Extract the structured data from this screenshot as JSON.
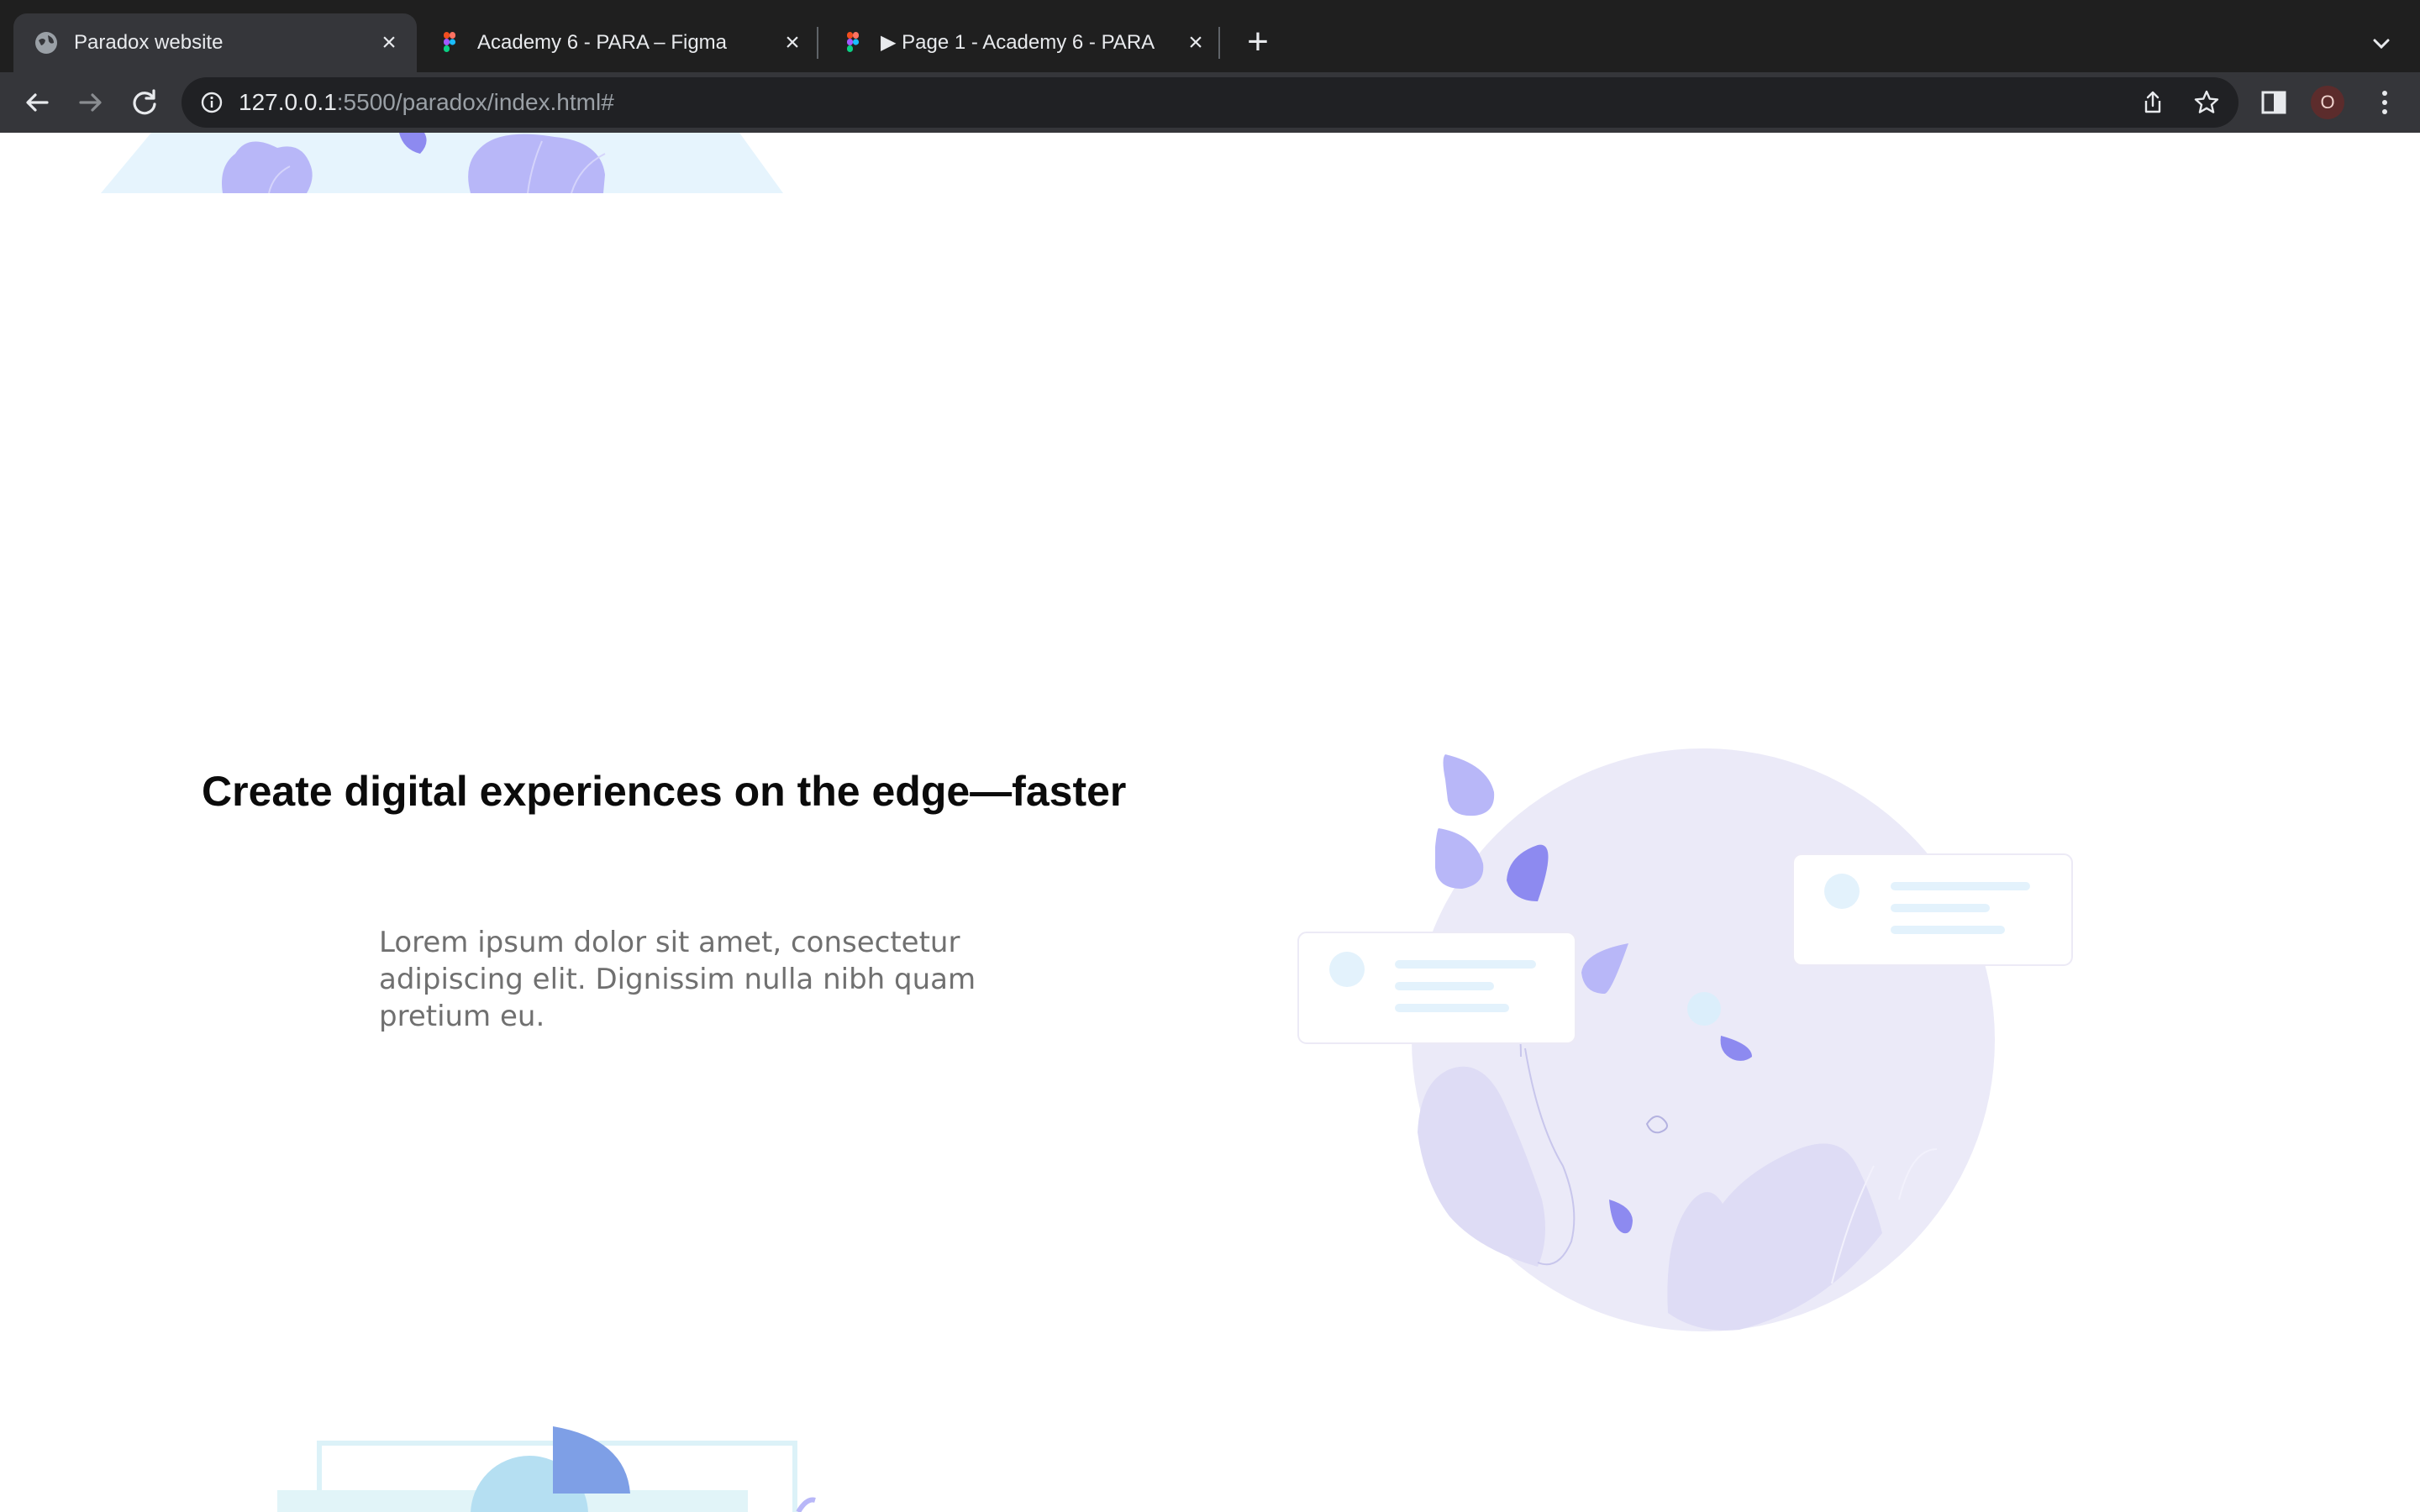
{
  "browser": {
    "tabs": [
      {
        "title": "Paradox website",
        "favicon": "globe-icon",
        "active": true
      },
      {
        "title": "Academy 6 - PARA – Figma",
        "favicon": "figma-icon",
        "active": false
      },
      {
        "title": "▶ Page 1 - Academy 6 - PARA",
        "favicon": "figma-icon",
        "active": false
      }
    ],
    "url_host": "127.0.0.1",
    "url_rest": ":5500/paradox/index.html#",
    "profile_initial": "O"
  },
  "content": {
    "headline": "Create digital experiences on the edge—faster",
    "body": "Lorem ipsum dolor sit amet, consectetur adipiscing elit. Dignissim nulla nibh quam pretium eu."
  },
  "colors": {
    "tab_bar": "#1f1f1f",
    "toolbar": "#35363a",
    "illustration_purple": "#b8b7f8",
    "globe_fill": "#ebeaf8",
    "heading": "#0b0b0b",
    "body_text": "#707070"
  }
}
